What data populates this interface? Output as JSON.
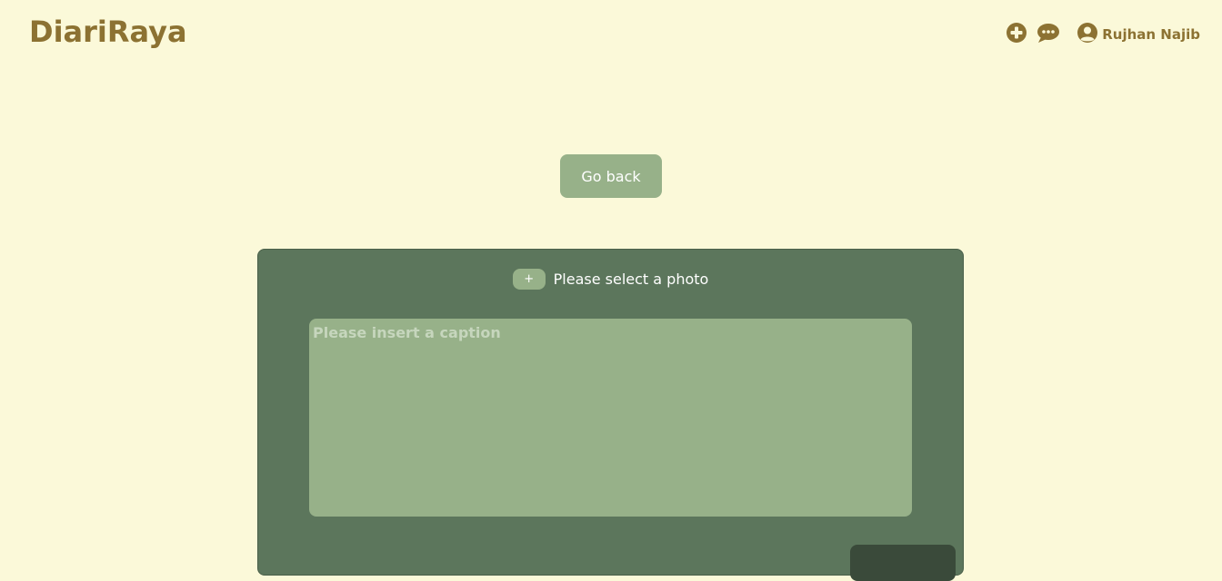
{
  "app": {
    "logo": "DiariRaya"
  },
  "nav": {
    "icons": [
      "plus-circle-icon",
      "chat-bubble-icon",
      "user-circle-icon"
    ],
    "user_name": "Rujhan Najib"
  },
  "main": {
    "go_back_label": "Go back"
  },
  "form": {
    "add_photo_label": "+",
    "photo_prompt": "Please select a photo",
    "caption_placeholder": "Please insert a caption",
    "caption_value": ""
  },
  "colors": {
    "background": "#fbf9d9",
    "brand": "#8c7232",
    "accent": "#97b189",
    "panel": "#5c765c",
    "submit": "#3a4a3a"
  }
}
